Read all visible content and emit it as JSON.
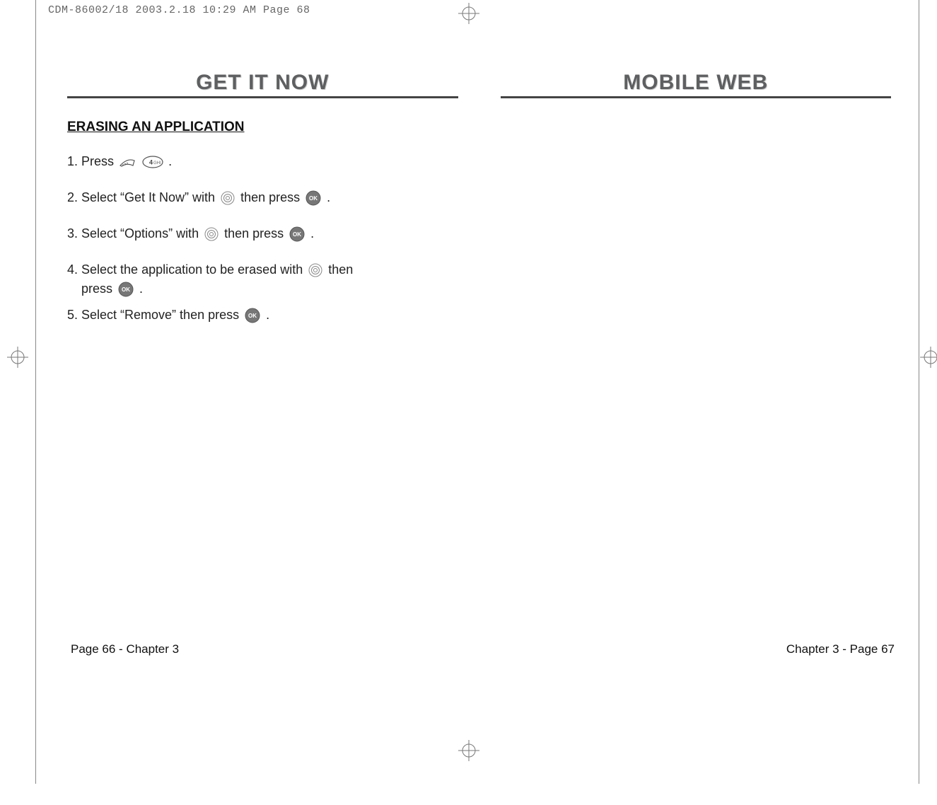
{
  "header": {
    "slug": "CDM-86002/18  2003.2.18  10:29 AM  Page 68"
  },
  "left_page": {
    "title": "GET IT NOW",
    "subhead": "ERASING AN APPLICATION",
    "steps": {
      "s1a": "1. Press ",
      "s1b": " .",
      "s2a": "2. Select “Get It Now” with ",
      "s2b": " then press  ",
      "s2c": " .",
      "s3a": "3. Select “Options” with ",
      "s3b": " then press  ",
      "s3c": "  .",
      "s4a": "4. Select the application to be erased with ",
      "s4b": " then",
      "s4c": "press ",
      "s4d": "  .",
      "s5a": "5. Select “Remove” then press  ",
      "s5b": "  ."
    },
    "footer": "Page 66 - Chapter 3"
  },
  "right_page": {
    "title": "MOBILE WEB",
    "footer": "Chapter 3 - Page 67"
  },
  "icons": {
    "soft_key": "soft-key-icon",
    "key4": "keypad-4-icon",
    "nav": "nav-ring-icon",
    "ok": "ok-button-icon"
  }
}
